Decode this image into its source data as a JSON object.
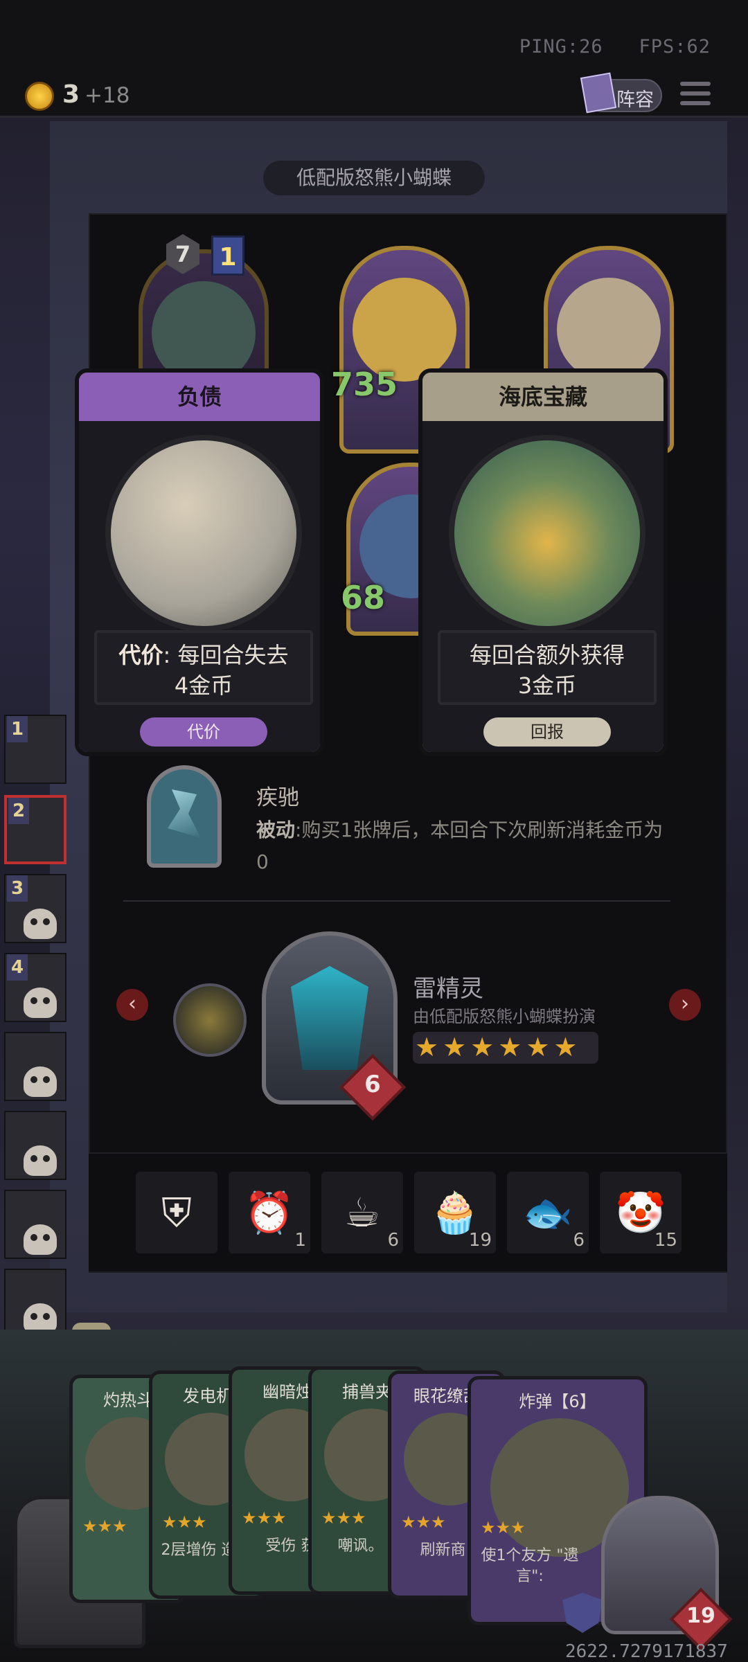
{
  "status": {
    "ping": "PING:26",
    "fps": "FPS:62"
  },
  "gold": {
    "amount": "3",
    "income": "+18"
  },
  "header": {
    "lineup_label": "阵容"
  },
  "team": {
    "title": "低配版怒熊小蝴蝶",
    "tier": "7",
    "level": "1"
  },
  "heroes": {
    "stat_a": "735",
    "stat_b": "68"
  },
  "cards": [
    {
      "title": "负债",
      "text_label": "代价",
      "text_body": "每回合失去",
      "text_amount": "4金币",
      "pill": "代价",
      "header_color": "#8b5fb5"
    },
    {
      "title": "海底宝藏",
      "text_body": "每回合额外获得",
      "text_amount": "3金币",
      "pill": "回报",
      "header_color": "#a79f8a"
    }
  ],
  "trait": {
    "name": "疾驰",
    "label": "被动",
    "desc": ":购买1张牌后，本回合下次刷新消耗金币为0"
  },
  "unit": {
    "name": "雷精灵",
    "player": "由低配版怒熊小蝴蝶扮演",
    "stars": 6,
    "hp": "6"
  },
  "items": [
    {
      "icon": "shield-icon",
      "glyph": "⛨",
      "count": ""
    },
    {
      "icon": "alarm-clock-icon",
      "glyph": "⏰",
      "count": "1"
    },
    {
      "icon": "teacup-icon",
      "glyph": "☕",
      "count": "6"
    },
    {
      "icon": "cupcake-icon",
      "glyph": "🧁",
      "count": "19"
    },
    {
      "icon": "fish-icon",
      "glyph": "🐟",
      "count": "6"
    },
    {
      "icon": "clown-icon",
      "glyph": "🤡",
      "count": "15"
    }
  ],
  "sidebar": {
    "numbers": [
      "1",
      "2",
      "3",
      "4"
    ]
  },
  "hand": [
    {
      "title": "灼热斗",
      "text": "",
      "color": "#3b5a4a"
    },
    {
      "title": "发电机",
      "text": "2层增伤 造成4",
      "color": "#2f4a3a"
    },
    {
      "title": "幽暗烛",
      "text": "受伤 获",
      "color": "#2f4a3a"
    },
    {
      "title": "捕兽夹",
      "text": "嘲讽。 久",
      "color": "#2f4a3a"
    },
    {
      "title": "眼花缭乱",
      "text": "刷新商 6",
      "color": "#4a3a6a"
    },
    {
      "title": "炸弹【6】",
      "text": "使1个友方 \"遗言\":",
      "color": "#4a3a6a"
    }
  ],
  "chest": {
    "count": "0"
  },
  "hero": {
    "hp": "19"
  },
  "footer": {
    "coords": "2622.7279171837"
  }
}
